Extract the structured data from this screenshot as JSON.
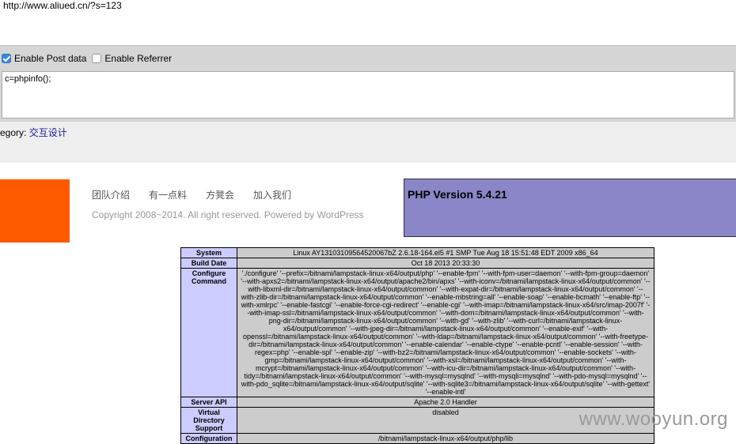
{
  "url": "http://www.aliued.cn/?s=123",
  "post_panel": {
    "enable_post_label": "Enable Post data",
    "enable_post_checked": true,
    "enable_referrer_label": "Enable Referrer",
    "enable_referrer_checked": false,
    "post_body": "c=phpinfo();"
  },
  "category": {
    "label": "egory: ",
    "value": "交互设计"
  },
  "site_nav": [
    "团队介绍",
    "有一点料",
    "方凳会",
    "加入我们"
  ],
  "copyright": "Copyright 2008~2014. All right reserved. Powered by WordPress",
  "php": {
    "version_title": "PHP Version 5.4.21",
    "rows": [
      {
        "key": "System",
        "value": "Linux AY13103109564520067bZ 2.6.18-164.el5 #1 SMP Tue Aug 18 15:51:48 EDT 2009 x86_64"
      },
      {
        "key": "Build Date",
        "value": "Oct 18 2013 20:33:30"
      },
      {
        "key": "Configure Command",
        "value": "'./configure' '--prefix=/bitnami/lampstack-linux-x64/output/php' '--enable-fpm' '--with-fpm-user=daemon' '--with-fpm-group=daemon' '--with-apxs2=/bitnami/lampstack-linux-x64/output/apache2/bin/apxs' '--with-iconv=/bitnami/lampstack-linux-x64/output/common' '--with-libxml-dir=/bitnami/lampstack-linux-x64/output/common' '--with-expat-dir=/bitnami/lampstack-linux-x64/output/common' '--with-zlib-dir=/bitnami/lampstack-linux-x64/output/common' '--enable-mbstring=all' '--enable-soap' '--enable-bcmath' '--enable-ftp' '--with-xmlrpc' '--enable-fastcgi' '--enable-force-cgi-redirect' '--enable-cgi' '--with-imap=/bitnami/lampstack-linux-x64/src/imap-2007f' '--with-imap-ssl=/bitnami/lampstack-linux-x64/output/common' '--with-dom=/bitnami/lampstack-linux-x64/output/common' '--with-png-dir=/bitnami/lampstack-linux-x64/output/common' '--with-gd' '--with-zlib' '--with-curl=/bitnami/lampstack-linux-x64/output/common' '--with-jpeg-dir=/bitnami/lampstack-linux-x64/output/common' '--enable-exif' '--with-openssl=/bitnami/lampstack-linux-x64/output/common' '--with-ldap=/bitnami/lampstack-linux-x64/output/common' '--with-freetype-dir=/bitnami/lampstack-linux-x64/output/common' '--enable-calendar' '--enable-ctype' '--enable-pcntl' '--enable-session' '--with-regex=php' '--enable-spl' '--enable-zip' '--with-bz2=/bitnami/lampstack-linux-x64/output/common' '--enable-sockets' '--with-gmp=/bitnami/lampstack-linux-x64/output/common' '--with-xsl=/bitnami/lampstack-linux-x64/output/common' '--with-mcrypt=/bitnami/lampstack-linux-x64/output/common' '--with-icu-dir=/bitnami/lampstack-linux-x64/output/common' '--with-tidy=/bitnami/lampstack-linux-x64/output/common' '--with-mysql=mysqlnd' '--with-mysqli=mysqlnd' '--with-pdo-mysql=mysqlnd' '--with-pdo_sqlite=/bitnami/lampstack-linux-x64/output/sqlite' '--with-sqlite3=/bitnami/lampstack-linux-x64/output/sqlite' '--with-gettext' '--enable-intl'"
      },
      {
        "key": "Server API",
        "value": "Apache 2.0 Handler"
      },
      {
        "key": "Virtual Directory Support",
        "value": "disabled"
      },
      {
        "key": "Configuration",
        "value": "/bitnami/lampstack-linux-x64/output/php/lib"
      }
    ]
  },
  "watermark": "www.wooyun.org",
  "colors": {
    "orange_block": "#ff5a00",
    "php_header": "#8a86c8",
    "php_key": "#ccccff",
    "php_value": "#cccccc",
    "checkbox_on": "#3b86e0"
  }
}
